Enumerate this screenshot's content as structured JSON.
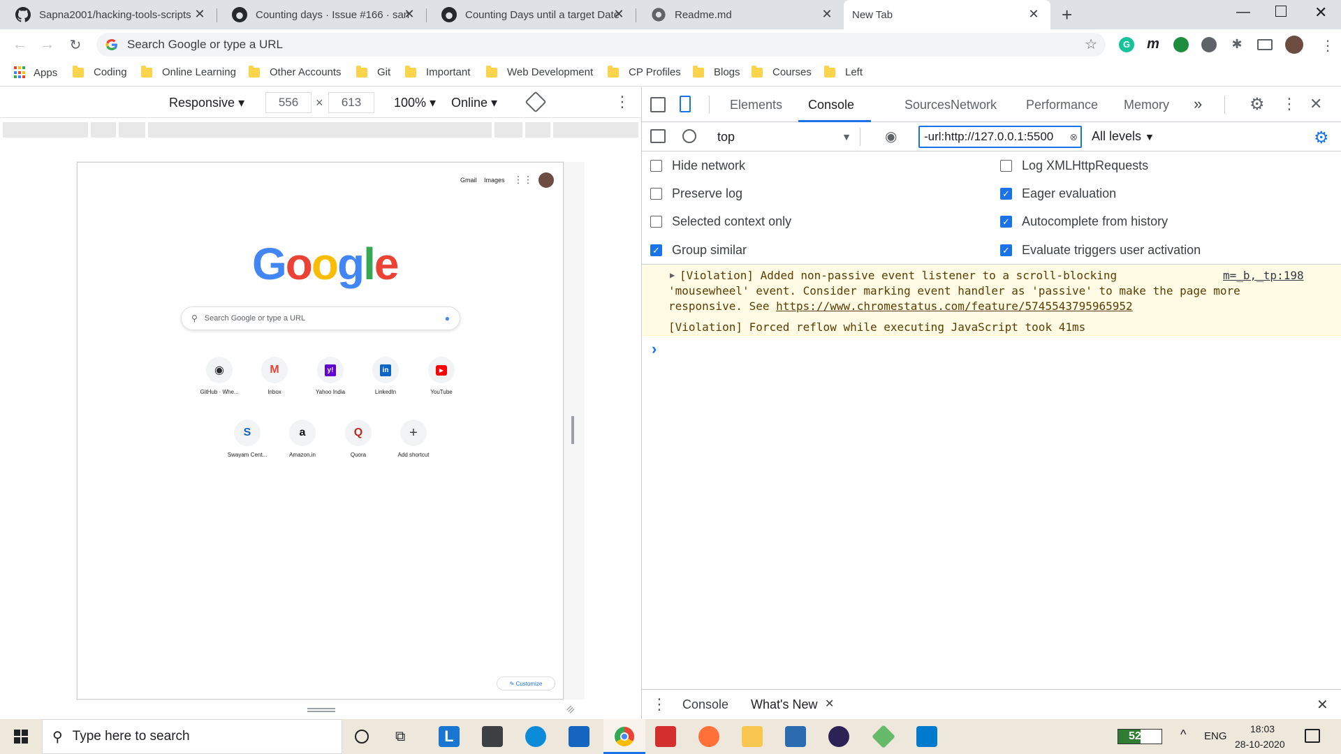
{
  "tabs": [
    {
      "title": "Sapna2001/hacking-tools-scripts",
      "icon": "github-icon"
    },
    {
      "title": "Counting days · Issue #166 · sans",
      "icon": "github-icon"
    },
    {
      "title": "Counting Days until a target Date",
      "icon": "github-icon"
    },
    {
      "title": "Readme.md",
      "icon": "globe-icon"
    },
    {
      "title": "New Tab",
      "icon": "none",
      "active": true
    }
  ],
  "toolbar": {
    "omnibox_placeholder": "Search Google or type a URL"
  },
  "bookmarks": [
    "Apps",
    "Coding",
    "Online Learning",
    "Other Accounts",
    "Git",
    "Important",
    "Web Development",
    "CP Profiles",
    "Blogs",
    "Courses",
    "Left"
  ],
  "device": {
    "mode": "Responsive",
    "width": "556",
    "times": "×",
    "height": "613",
    "zoom": "100%",
    "network": "Online"
  },
  "newtab": {
    "gmail": "Gmail",
    "images": "Images",
    "logo": [
      "G",
      "o",
      "o",
      "g",
      "l",
      "e"
    ],
    "logo_colors": [
      "#4285f4",
      "#ea4335",
      "#fbbc05",
      "#4285f4",
      "#34a853",
      "#ea4335"
    ],
    "search_placeholder": "Search Google or type a URL",
    "shortcuts": [
      {
        "label": "GitHub · Whe...",
        "glyph": "◉",
        "color": "#24292e"
      },
      {
        "label": "Inbox",
        "glyph": "M",
        "color": "#ea4335"
      },
      {
        "label": "Yahoo India",
        "glyph": "y!",
        "color": "#ffffff",
        "bg": "#6001d2"
      },
      {
        "label": "LinkedIn",
        "glyph": "in",
        "color": "#ffffff",
        "bg": "#0a66c2"
      },
      {
        "label": "YouTube",
        "glyph": "▶",
        "color": "#ffffff",
        "bg": "#ff0000"
      },
      {
        "label": "Swayam Cent...",
        "glyph": "S",
        "color": "#1565c0"
      },
      {
        "label": "Amazon.in",
        "glyph": "a",
        "color": "#111111"
      },
      {
        "label": "Quora",
        "glyph": "Q",
        "color": "#b92b27"
      },
      {
        "label": "Add shortcut",
        "glyph": "+",
        "color": "#3c4043"
      }
    ],
    "customize": "Customize"
  },
  "devtools": {
    "tabs": [
      "Elements",
      "Console",
      "Sources",
      "Network",
      "Performance",
      "Memory"
    ],
    "overflow": "»",
    "context": "top",
    "filter_value": "-url:http://127.0.0.1:5500",
    "levels": "All levels",
    "settings_left": [
      {
        "label": "Hide network",
        "checked": false
      },
      {
        "label": "Preserve log",
        "checked": false
      },
      {
        "label": "Selected context only",
        "checked": false
      },
      {
        "label": "Group similar",
        "checked": true
      }
    ],
    "settings_right": [
      {
        "label": "Log XMLHttpRequests",
        "checked": false
      },
      {
        "label": "Eager evaluation",
        "checked": true
      },
      {
        "label": "Autocomplete from history",
        "checked": true
      },
      {
        "label": "Evaluate triggers user activation",
        "checked": true
      }
    ],
    "messages": {
      "violation1_line1": "[Violation] Added non-passive event listener to a scroll-blocking",
      "violation1_line2": "'mousewheel' event. Consider marking event handler as 'passive' to make the page more",
      "violation1_line3_prefix": "responsive. See ",
      "violation1_link": "https://www.chromestatus.com/feature/5745543795965952",
      "violation1_source": "m=_b,_tp:198",
      "violation2": "[Violation] Forced reflow while executing JavaScript took 41ms",
      "prompt": "›"
    },
    "drawer_tabs": [
      "Console",
      "What's New"
    ]
  },
  "taskbar": {
    "search_placeholder": "Type here to search",
    "battery": "52%",
    "language": "ENG",
    "time": "18:03",
    "date": "28-10-2020"
  }
}
